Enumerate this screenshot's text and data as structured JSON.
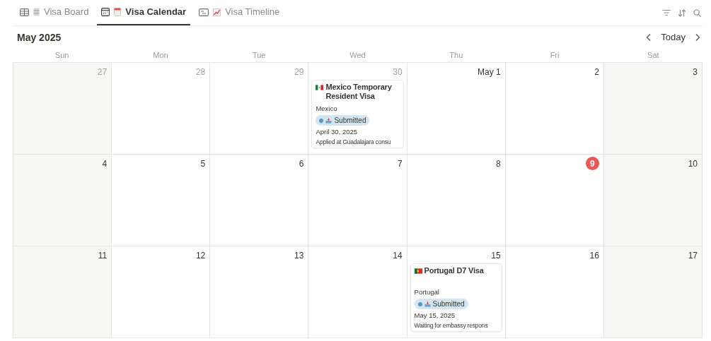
{
  "tabs": [
    {
      "label": "Visa Board",
      "kind": "board",
      "selected": false
    },
    {
      "label": "Visa Calendar",
      "kind": "calendar",
      "selected": true
    },
    {
      "label": "Visa Timeline",
      "kind": "timeline",
      "selected": false
    }
  ],
  "month": "May 2025",
  "today_button": "Today",
  "weekdays": [
    "Sun",
    "Mon",
    "Tue",
    "Wed",
    "Thu",
    "Fri",
    "Sat"
  ],
  "weeks": [
    {
      "days": [
        {
          "number": "27",
          "outside": true,
          "today": false
        },
        {
          "number": "28",
          "outside": true,
          "today": false
        },
        {
          "number": "29",
          "outside": true,
          "today": false
        },
        {
          "number": "30",
          "outside": true,
          "today": false,
          "events": [
            {
              "title": "Mexico Temporary Resident Visa",
              "kind": "mexico",
              "country": "Mexico",
              "status": "Submitted",
              "date": "April 30, 2025",
              "note": "Applied at Guadalajara consu"
            }
          ]
        },
        {
          "number": "May 1",
          "outside": false,
          "today": false
        },
        {
          "number": "2",
          "outside": false,
          "today": false
        },
        {
          "number": "3",
          "outside": false,
          "today": false
        }
      ]
    },
    {
      "days": [
        {
          "number": "4",
          "outside": false,
          "today": false
        },
        {
          "number": "5",
          "outside": false,
          "today": false
        },
        {
          "number": "6",
          "outside": false,
          "today": false
        },
        {
          "number": "7",
          "outside": false,
          "today": false
        },
        {
          "number": "8",
          "outside": false,
          "today": false
        },
        {
          "number": "9",
          "outside": false,
          "today": true
        },
        {
          "number": "10",
          "outside": false,
          "today": false
        }
      ]
    },
    {
      "days": [
        {
          "number": "11",
          "outside": false,
          "today": false
        },
        {
          "number": "12",
          "outside": false,
          "today": false
        },
        {
          "number": "13",
          "outside": false,
          "today": false
        },
        {
          "number": "14",
          "outside": false,
          "today": false
        },
        {
          "number": "15",
          "outside": false,
          "today": false,
          "events": [
            {
              "title": "Portugal D7 Visa",
              "kind": "portugal",
              "country": "Portugal",
              "status": "Submitted",
              "date": "May 15, 2025",
              "note": "Waiting for embassy respons"
            }
          ]
        },
        {
          "number": "16",
          "outside": false,
          "today": false
        },
        {
          "number": "17",
          "outside": false,
          "today": false
        }
      ]
    }
  ]
}
